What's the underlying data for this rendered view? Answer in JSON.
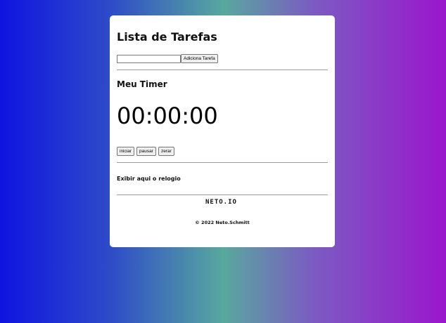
{
  "tasks": {
    "title": "Lista de Tarefas",
    "input_value": "",
    "add_button": "Adiciona Tarefa"
  },
  "timer": {
    "title": "Meu Timer",
    "display": "00:00:00",
    "start_button": "iniciar",
    "pause_button": "pausar",
    "reset_button": "zerar"
  },
  "clock": {
    "label": "Exibir aqui o relogio"
  },
  "footer": {
    "logo": "NETO.IO",
    "copyright": "© 2022 Neto.Schmitt"
  },
  "colors": {
    "gradient_left": "#0f14e0",
    "gradient_mid": "#58a89e",
    "gradient_right": "#9a16cc",
    "card_bg": "#ffffff"
  }
}
